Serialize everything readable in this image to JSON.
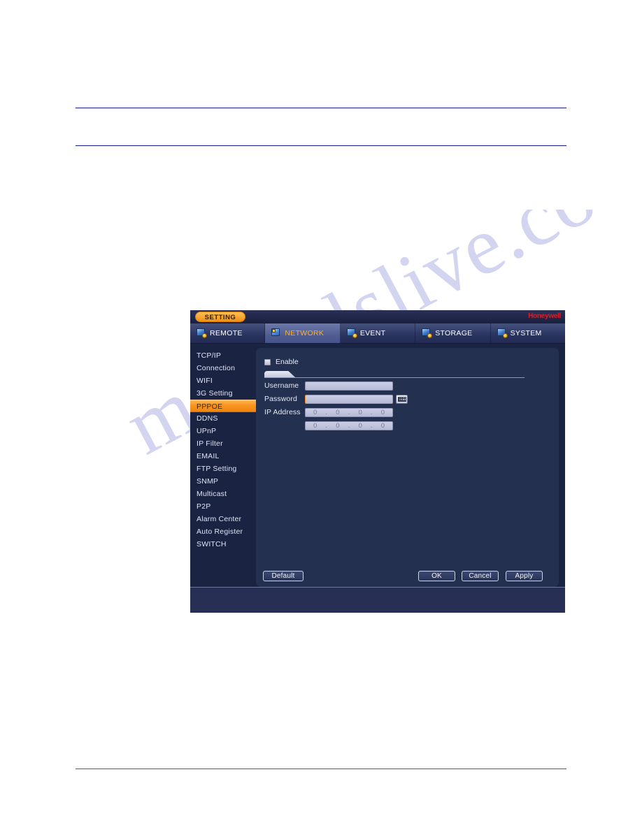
{
  "document": {
    "watermark": "manualslive.com"
  },
  "window": {
    "setting_badge": "SETTING",
    "brand": "Honeywell",
    "tabs": [
      {
        "label": "REMOTE",
        "icon": "remote-icon",
        "active": false
      },
      {
        "label": "NETWORK",
        "icon": "network-icon",
        "active": true
      },
      {
        "label": "EVENT",
        "icon": "event-icon",
        "active": false
      },
      {
        "label": "STORAGE",
        "icon": "storage-icon",
        "active": false
      },
      {
        "label": "SYSTEM",
        "icon": "system-icon",
        "active": false
      }
    ],
    "sidebar": {
      "items": [
        {
          "label": "TCP/IP",
          "selected": false
        },
        {
          "label": "Connection",
          "selected": false
        },
        {
          "label": "WIFI",
          "selected": false
        },
        {
          "label": "3G Setting",
          "selected": false
        },
        {
          "label": "PPPOE",
          "selected": true
        },
        {
          "label": "DDNS",
          "selected": false
        },
        {
          "label": "UPnP",
          "selected": false
        },
        {
          "label": "IP Filter",
          "selected": false
        },
        {
          "label": "EMAIL",
          "selected": false
        },
        {
          "label": "FTP Setting",
          "selected": false
        },
        {
          "label": "SNMP",
          "selected": false
        },
        {
          "label": "Multicast",
          "selected": false
        },
        {
          "label": "P2P",
          "selected": false
        },
        {
          "label": "Alarm Center",
          "selected": false
        },
        {
          "label": "Auto Register",
          "selected": false
        },
        {
          "label": "SWITCH",
          "selected": false
        }
      ]
    },
    "form": {
      "enable_label": "Enable",
      "enable_checked": false,
      "username_label": "Username",
      "username_value": "",
      "password_label": "Password",
      "password_value": "",
      "password_focused": true,
      "keyboard_icon": "keyboard-icon",
      "ip_label": "IP Address",
      "ip_rows": [
        {
          "octets": [
            "0",
            "0",
            "0",
            "0"
          ]
        },
        {
          "octets": [
            "0",
            "0",
            "0",
            "0"
          ]
        }
      ],
      "ip_separator": "."
    },
    "buttons": {
      "default": "Default",
      "ok": "OK",
      "cancel": "Cancel",
      "apply": "Apply"
    },
    "colors": {
      "accent_orange": "#f8941d",
      "brand_red": "#e41b23",
      "window_bg": "#1b2342",
      "panel_bg": "#24304f",
      "rule_navy": "#151a8c"
    }
  }
}
